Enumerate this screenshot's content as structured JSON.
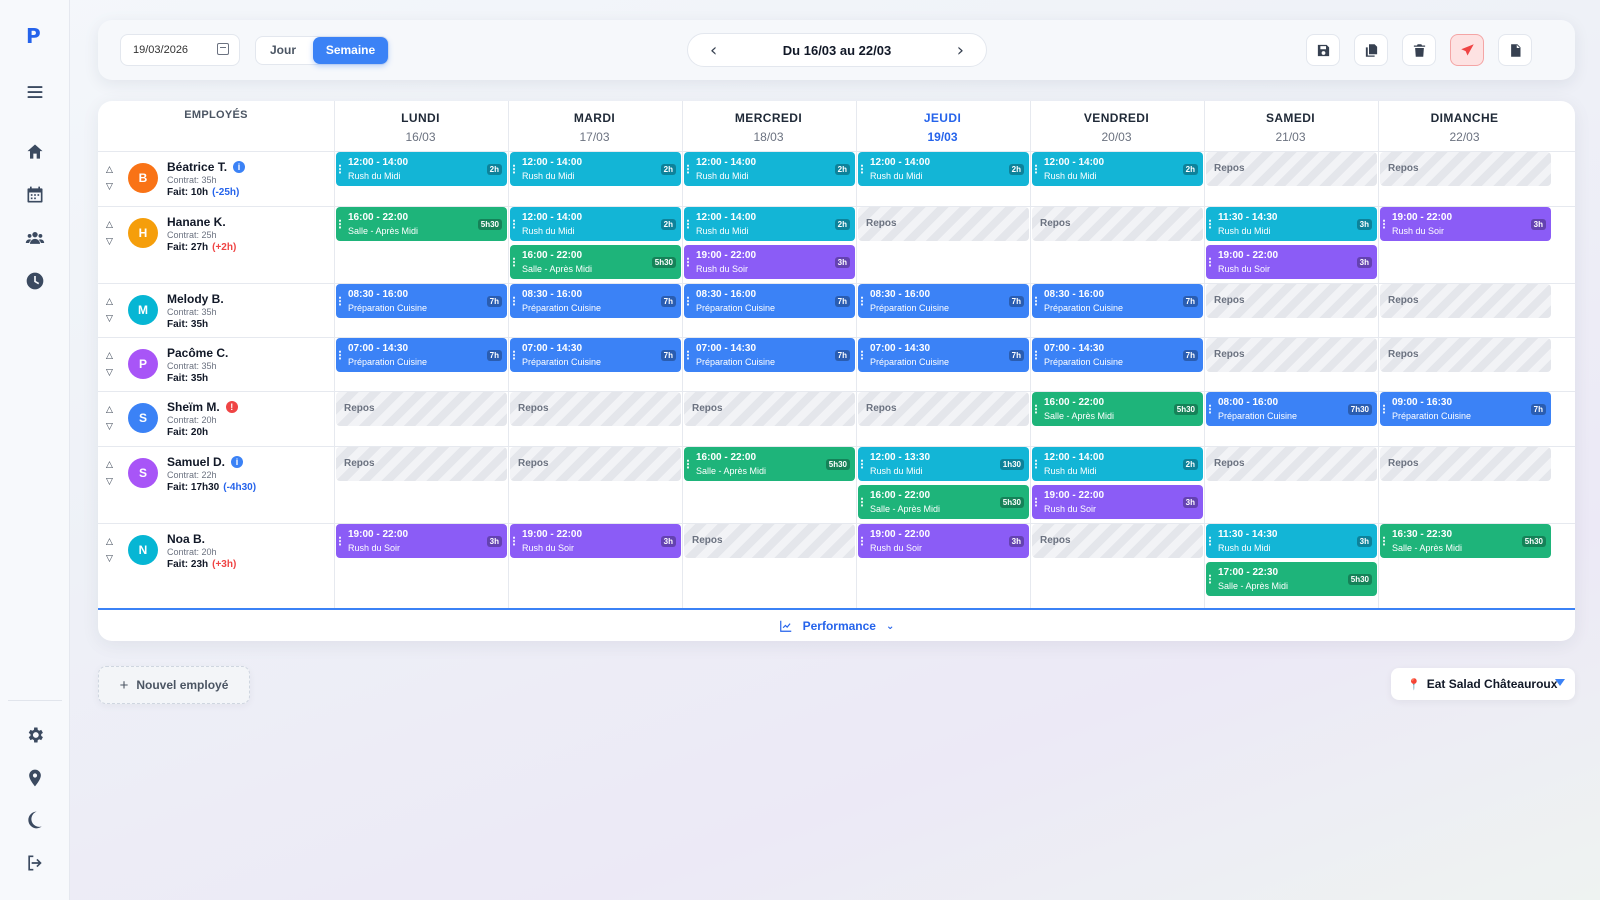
{
  "app": {
    "logo": "P"
  },
  "colors": {
    "accent": "#3b82f6",
    "midi": "#13b5d6",
    "salle": "#1eb47a",
    "soir": "#8b5cf6",
    "prep": "#3b82f6",
    "warning_red": "#ef4444",
    "info_blue": "#3b82f6"
  },
  "sidebar": {
    "top_icons": [
      "hamburger-menu-icon",
      "home-icon",
      "calendar-icon",
      "users-icon",
      "clock-icon"
    ],
    "bottom_icons": [
      "gear-icon",
      "map-pin-icon",
      "moon-icon",
      "logout-icon"
    ]
  },
  "toolbar": {
    "date_value": "19/03/2026",
    "view_day": "Jour",
    "view_week": "Semaine",
    "active_view": "Semaine",
    "prev": "‹",
    "next": "›",
    "week_label": "Du 16/03 au 22/03",
    "actions": [
      "save-icon",
      "copy-icon",
      "trash-icon",
      "send-icon",
      "pdf-icon"
    ]
  },
  "schedule": {
    "employees_header": "EMPLOYÉS",
    "days": [
      {
        "name": "LUNDI",
        "date": "16/03",
        "today": false
      },
      {
        "name": "MARDI",
        "date": "17/03",
        "today": false
      },
      {
        "name": "MERCREDI",
        "date": "18/03",
        "today": false
      },
      {
        "name": "JEUDI",
        "date": "19/03",
        "today": true
      },
      {
        "name": "VENDREDI",
        "date": "20/03",
        "today": false
      },
      {
        "name": "SAMEDI",
        "date": "21/03",
        "today": false
      },
      {
        "name": "DIMANCHE",
        "date": "22/03",
        "today": false
      }
    ],
    "employees": [
      {
        "initial": "B",
        "avatar_color": "#f97316",
        "name": "Béatrice T.",
        "badge": "i",
        "badge_color": "#3b82f6",
        "contract": "Contrat: 35h",
        "done": "Fait: 10h",
        "diff": "(-25h)",
        "diff_color": "#2563eb",
        "days": [
          [
            {
              "time": "12:00 - 14:00",
              "role": "Rush du Midi",
              "dur": "2h",
              "type": "midi"
            }
          ],
          [
            {
              "time": "12:00 - 14:00",
              "role": "Rush du Midi",
              "dur": "2h",
              "type": "midi"
            }
          ],
          [
            {
              "time": "12:00 - 14:00",
              "role": "Rush du Midi",
              "dur": "2h",
              "type": "midi"
            }
          ],
          [
            {
              "time": "12:00 - 14:00",
              "role": "Rush du Midi",
              "dur": "2h",
              "type": "midi"
            }
          ],
          [
            {
              "time": "12:00 - 14:00",
              "role": "Rush du Midi",
              "dur": "2h",
              "type": "midi"
            }
          ],
          "Repos",
          "Repos"
        ]
      },
      {
        "initial": "H",
        "avatar_color": "#f59e0b",
        "name": "Hanane K.",
        "badge": "",
        "badge_color": "",
        "contract": "Contrat: 25h",
        "done": "Fait: 27h",
        "diff": "(+2h)",
        "diff_color": "#ef4444",
        "days": [
          [
            {
              "time": "16:00 - 22:00",
              "role": "Salle - Après Midi",
              "dur": "5h30",
              "type": "salle"
            }
          ],
          [
            {
              "time": "12:00 - 14:00",
              "role": "Rush du Midi",
              "dur": "2h",
              "type": "midi"
            },
            {
              "time": "16:00 - 22:00",
              "role": "Salle - Après Midi",
              "dur": "5h30",
              "type": "salle"
            }
          ],
          [
            {
              "time": "12:00 - 14:00",
              "role": "Rush du Midi",
              "dur": "2h",
              "type": "midi"
            },
            {
              "time": "19:00 - 22:00",
              "role": "Rush du Soir",
              "dur": "3h",
              "type": "soir"
            }
          ],
          "Repos",
          "Repos",
          [
            {
              "time": "11:30 - 14:30",
              "role": "Rush du Midi",
              "dur": "3h",
              "type": "midi"
            },
            {
              "time": "19:00 - 22:00",
              "role": "Rush du Soir",
              "dur": "3h",
              "type": "soir"
            }
          ],
          [
            {
              "time": "19:00 - 22:00",
              "role": "Rush du Soir",
              "dur": "3h",
              "type": "soir"
            }
          ]
        ]
      },
      {
        "initial": "M",
        "avatar_color": "#06b6d4",
        "name": "Melody B.",
        "badge": "",
        "badge_color": "",
        "contract": "Contrat: 35h",
        "done": "Fait: 35h",
        "diff": "",
        "diff_color": "",
        "days": [
          [
            {
              "time": "08:30 - 16:00",
              "role": "Préparation Cuisine",
              "dur": "7h",
              "type": "prep"
            }
          ],
          [
            {
              "time": "08:30 - 16:00",
              "role": "Préparation Cuisine",
              "dur": "7h",
              "type": "prep"
            }
          ],
          [
            {
              "time": "08:30 - 16:00",
              "role": "Préparation Cuisine",
              "dur": "7h",
              "type": "prep"
            }
          ],
          [
            {
              "time": "08:30 - 16:00",
              "role": "Préparation Cuisine",
              "dur": "7h",
              "type": "prep"
            }
          ],
          [
            {
              "time": "08:30 - 16:00",
              "role": "Préparation Cuisine",
              "dur": "7h",
              "type": "prep"
            }
          ],
          "Repos",
          "Repos"
        ]
      },
      {
        "initial": "P",
        "avatar_color": "#a855f7",
        "name": "Pacôme C.",
        "badge": "",
        "badge_color": "",
        "contract": "Contrat: 35h",
        "done": "Fait: 35h",
        "diff": "",
        "diff_color": "",
        "days": [
          [
            {
              "time": "07:00 - 14:30",
              "role": "Préparation Cuisine",
              "dur": "7h",
              "type": "prep"
            }
          ],
          [
            {
              "time": "07:00 - 14:30",
              "role": "Préparation Cuisine",
              "dur": "7h",
              "type": "prep"
            }
          ],
          [
            {
              "time": "07:00 - 14:30",
              "role": "Préparation Cuisine",
              "dur": "7h",
              "type": "prep"
            }
          ],
          [
            {
              "time": "07:00 - 14:30",
              "role": "Préparation Cuisine",
              "dur": "7h",
              "type": "prep"
            }
          ],
          [
            {
              "time": "07:00 - 14:30",
              "role": "Préparation Cuisine",
              "dur": "7h",
              "type": "prep"
            }
          ],
          "Repos",
          "Repos"
        ]
      },
      {
        "initial": "S",
        "avatar_color": "#3b82f6",
        "name": "Sheïm M.",
        "badge": "!",
        "badge_color": "#ef4444",
        "contract": "Contrat: 20h",
        "done": "Fait: 20h",
        "diff": "",
        "diff_color": "",
        "days": [
          "Repos",
          "Repos",
          "Repos",
          "Repos",
          [
            {
              "time": "16:00 - 22:00",
              "role": "Salle - Après Midi",
              "dur": "5h30",
              "type": "salle"
            }
          ],
          [
            {
              "time": "08:00 - 16:00",
              "role": "Préparation Cuisine",
              "dur": "7h30",
              "type": "prep"
            }
          ],
          [
            {
              "time": "09:00 - 16:30",
              "role": "Préparation Cuisine",
              "dur": "7h",
              "type": "prep"
            }
          ]
        ]
      },
      {
        "initial": "S",
        "avatar_color": "#a855f7",
        "name": "Samuel D.",
        "badge": "i",
        "badge_color": "#3b82f6",
        "contract": "Contrat: 22h",
        "done": "Fait: 17h30",
        "diff": "(-4h30)",
        "diff_color": "#2563eb",
        "days": [
          "Repos",
          "Repos",
          [
            {
              "time": "16:00 - 22:00",
              "role": "Salle - Après Midi",
              "dur": "5h30",
              "type": "salle"
            }
          ],
          [
            {
              "time": "12:00 - 13:30",
              "role": "Rush du Midi",
              "dur": "1h30",
              "type": "midi"
            },
            {
              "time": "16:00 - 22:00",
              "role": "Salle - Après Midi",
              "dur": "5h30",
              "type": "salle"
            }
          ],
          [
            {
              "time": "12:00 - 14:00",
              "role": "Rush du Midi",
              "dur": "2h",
              "type": "midi"
            },
            {
              "time": "19:00 - 22:00",
              "role": "Rush du Soir",
              "dur": "3h",
              "type": "soir"
            }
          ],
          "Repos",
          "Repos"
        ]
      },
      {
        "initial": "N",
        "avatar_color": "#06b6d4",
        "name": "Noa B.",
        "badge": "",
        "badge_color": "",
        "contract": "Contrat: 20h",
        "done": "Fait: 23h",
        "diff": "(+3h)",
        "diff_color": "#ef4444",
        "days": [
          [
            {
              "time": "19:00 - 22:00",
              "role": "Rush du Soir",
              "dur": "3h",
              "type": "soir"
            }
          ],
          [
            {
              "time": "19:00 - 22:00",
              "role": "Rush du Soir",
              "dur": "3h",
              "type": "soir"
            }
          ],
          "Repos",
          [
            {
              "time": "19:00 - 22:00",
              "role": "Rush du Soir",
              "dur": "3h",
              "type": "soir"
            }
          ],
          "Repos",
          [
            {
              "time": "11:30 - 14:30",
              "role": "Rush du Midi",
              "dur": "3h",
              "type": "midi"
            },
            {
              "time": "17:00 - 22:30",
              "role": "Salle - Après Midi",
              "dur": "5h30",
              "type": "salle"
            }
          ],
          [
            {
              "time": "16:30 - 22:30",
              "role": "Salle - Après Midi",
              "dur": "5h30",
              "type": "salle"
            }
          ]
        ]
      }
    ],
    "performance_label": "Performance"
  },
  "footer": {
    "new_employee": "Nouvel employé",
    "location": "Eat Salad Châteauroux"
  }
}
